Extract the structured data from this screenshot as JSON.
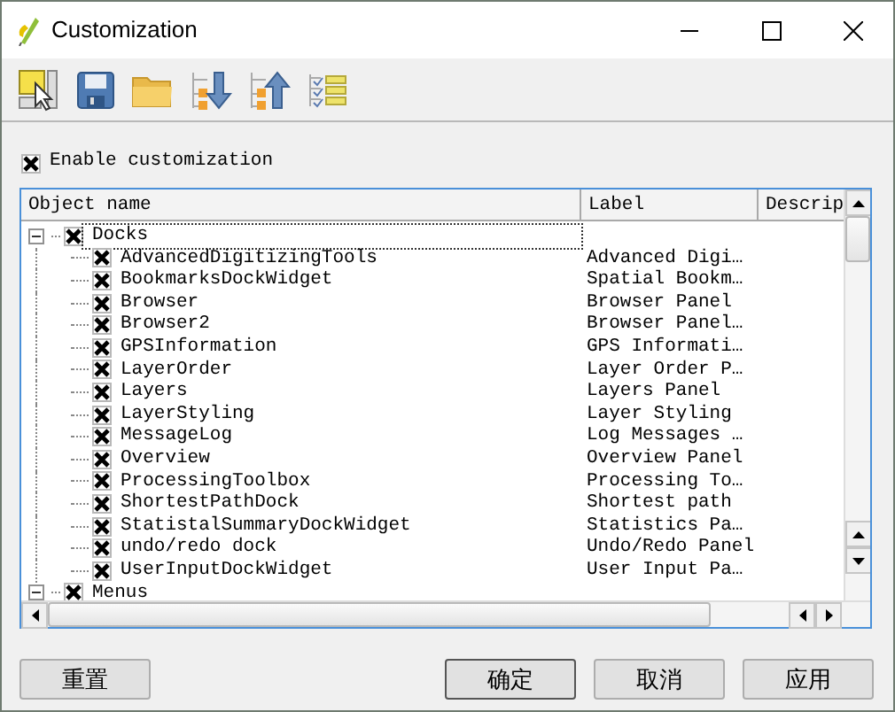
{
  "window": {
    "title": "Customization"
  },
  "enable_customization": {
    "label": "Enable customization",
    "checked": true
  },
  "tree": {
    "columns": [
      "Object name",
      "Label",
      "Descrip"
    ],
    "items": [
      {
        "name": "Docks",
        "checked": true,
        "expanded": true,
        "current": true,
        "children": [
          {
            "name": "AdvancedDigitizingTools",
            "label": "Advanced Digi…",
            "checked": true,
            "current": false
          },
          {
            "name": "BookmarksDockWidget",
            "label": "Spatial Bookm…",
            "checked": true,
            "current": false
          },
          {
            "name": "Browser",
            "label": "Browser Panel",
            "checked": true,
            "current": false
          },
          {
            "name": "Browser2",
            "label": "Browser Panel…",
            "checked": true,
            "current": false
          },
          {
            "name": "GPSInformation",
            "label": "GPS Informati…",
            "checked": true,
            "current": false
          },
          {
            "name": "LayerOrder",
            "label": "Layer Order P…",
            "checked": true,
            "current": false
          },
          {
            "name": "Layers",
            "label": "Layers Panel",
            "checked": true,
            "current": false
          },
          {
            "name": "LayerStyling",
            "label": "Layer Styling",
            "checked": true,
            "current": false
          },
          {
            "name": "MessageLog",
            "label": "Log Messages …",
            "checked": true,
            "current": false
          },
          {
            "name": "Overview",
            "label": "Overview Panel",
            "checked": true,
            "current": false
          },
          {
            "name": "ProcessingToolbox",
            "label": "Processing To…",
            "checked": true,
            "current": false
          },
          {
            "name": "ShortestPathDock",
            "label": "Shortest path",
            "checked": true,
            "current": false
          },
          {
            "name": "StatistalSummaryDockWidget",
            "label": "Statistics Pa…",
            "checked": true,
            "current": false
          },
          {
            "name": "undo/redo dock",
            "label": "Undo/Redo Panel",
            "checked": true,
            "current": false
          },
          {
            "name": "UserInputDockWidget",
            "label": "User Input Pa…",
            "checked": true,
            "current": false
          }
        ]
      },
      {
        "name": "Menus",
        "checked": true,
        "expanded": true,
        "current": false
      }
    ]
  },
  "buttons": [
    {
      "label": "重置",
      "default": false
    },
    {
      "label": "确定",
      "default": true
    },
    {
      "label": "取消",
      "default": false
    },
    {
      "label": "应用",
      "default": false
    }
  ]
}
